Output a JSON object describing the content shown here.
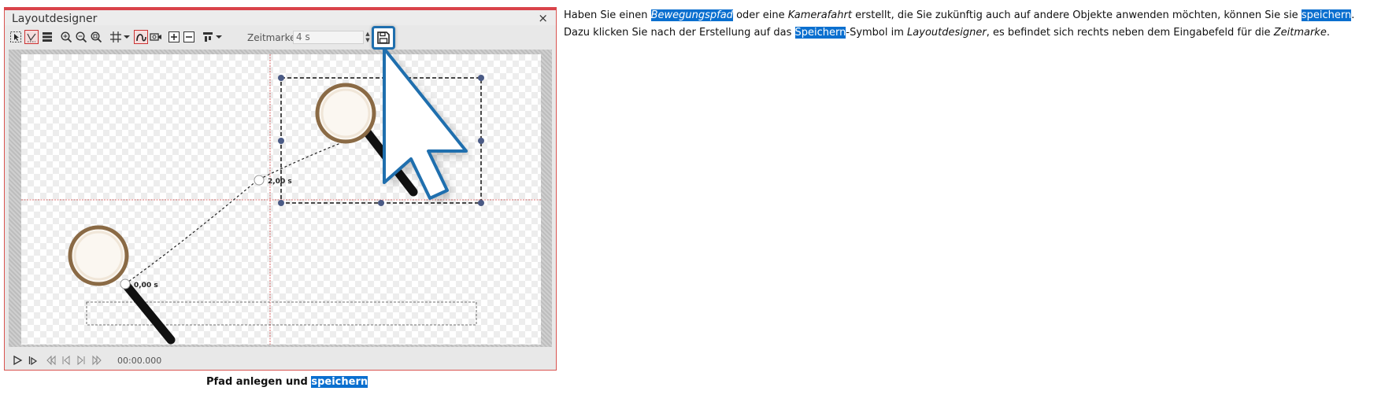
{
  "window": {
    "title": "Layoutdesigner",
    "close_glyph": "×"
  },
  "toolbar": {
    "time_label": "Zeitmarke:",
    "time_value": "4 s",
    "icons": [
      "select-icon",
      "path-tool-icon",
      "layers-icon",
      "zoom-in-icon",
      "zoom-out-icon",
      "zoom-fit-icon",
      "grid-icon",
      "curve-icon",
      "camera-icon",
      "add-point-icon",
      "remove-point-icon",
      "align-icon",
      "save-icon"
    ]
  },
  "canvas": {
    "start_label": "0,00 s",
    "mid_label": "2,00 s"
  },
  "playback": {
    "time": "00:00.000"
  },
  "caption": {
    "text": "Pfad anlegen und ",
    "highlight": "speichern"
  },
  "paragraph": {
    "t1": "Haben Sie einen ",
    "h1": "Bewegungspfad",
    "t2": " oder eine ",
    "i1": "Kamerafahrt",
    "t3": " erstellt, die Sie zukünftig auch auf andere Objekte anwenden möchten, können Sie sie ",
    "h2": "speichern",
    "t4": ". Dazu klicken Sie nach der Erstellung auf das ",
    "h3": "Speichern",
    "t5": "-Symbol im ",
    "i2": "Layoutdesigner",
    "t6": ", es befindet sich rechts neben dem Eingabefeld für die ",
    "i3": "Zeitmarke",
    "t7": "."
  },
  "colors": {
    "highlight": "#0a6fcf",
    "window_border": "#d9434a",
    "save_button_border": "#1f6fae"
  }
}
